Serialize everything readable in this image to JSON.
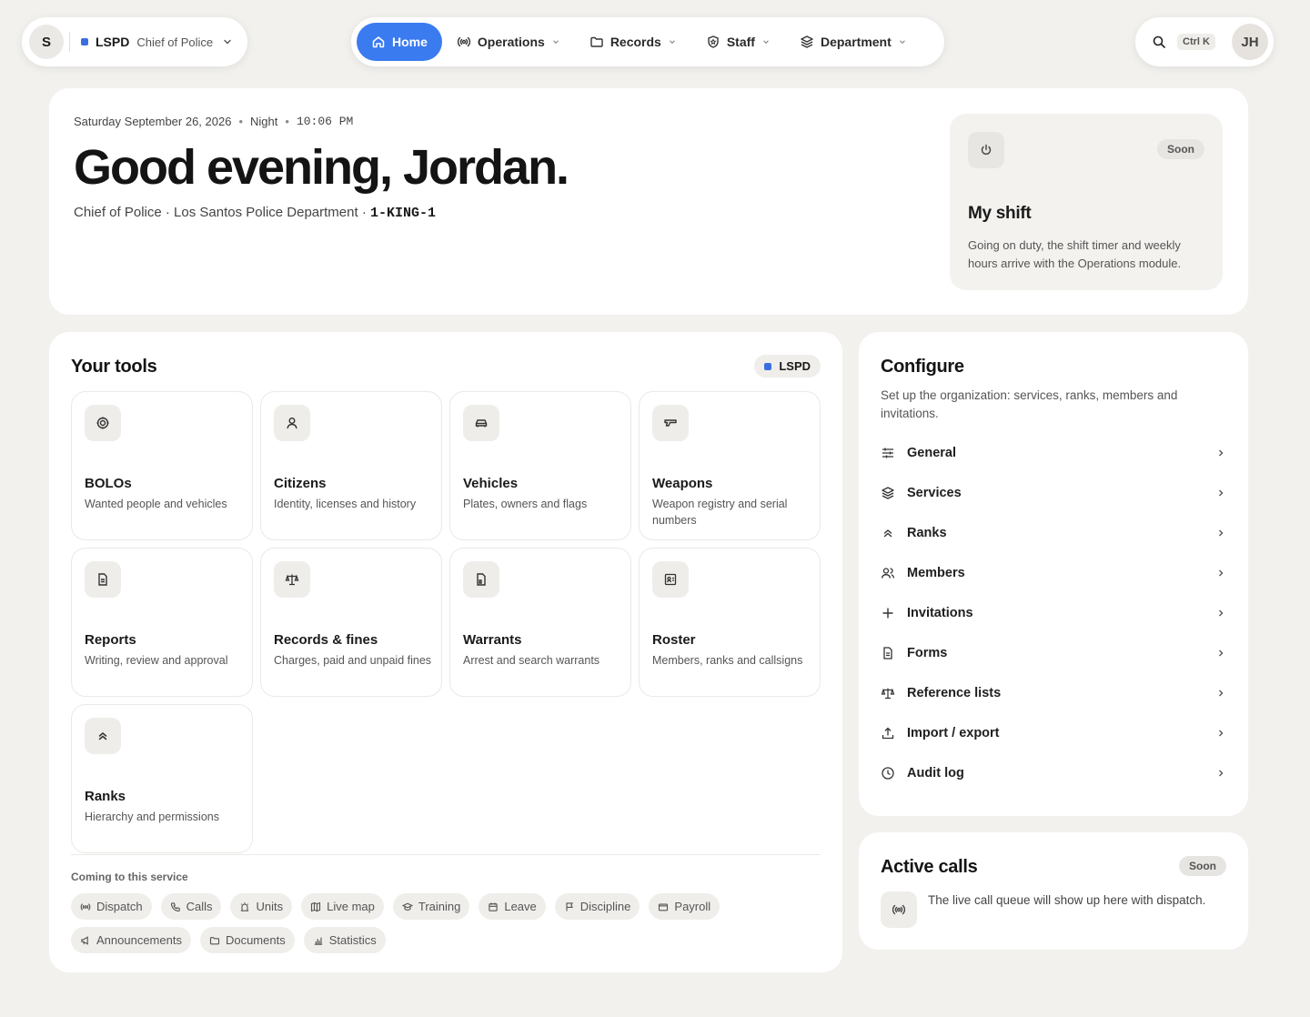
{
  "org_switcher": {
    "avatar": "S",
    "org": "LSPD",
    "role": "Chief of Police"
  },
  "nav": [
    {
      "label": "Home",
      "icon": "home-icon",
      "active": true
    },
    {
      "label": "Operations",
      "icon": "radio-icon"
    },
    {
      "label": "Records",
      "icon": "folder-icon"
    },
    {
      "label": "Staff",
      "icon": "shield-icon"
    },
    {
      "label": "Department",
      "icon": "layers-icon"
    }
  ],
  "utility": {
    "shortcut": "Ctrl K",
    "user_initials": "JH"
  },
  "hero": {
    "date": "Saturday September 26, 2026",
    "period": "Night",
    "time": "10:06 PM",
    "greeting": "Good evening, Jordan.",
    "subline": "Chief of Police · Los Santos Police Department ·",
    "callsign": "1-KING-1"
  },
  "shift": {
    "badge": "Soon",
    "title": "My shift",
    "description": "Going on duty, the shift timer and weekly hours arrive with the Operations module."
  },
  "tools": {
    "title": "Your tools",
    "tag": "LSPD",
    "items": [
      {
        "title": "BOLOs",
        "desc": "Wanted people and vehicles",
        "icon": "target-icon"
      },
      {
        "title": "Citizens",
        "desc": "Identity, licenses and history",
        "icon": "user-icon"
      },
      {
        "title": "Vehicles",
        "desc": "Plates, owners and flags",
        "icon": "car-icon"
      },
      {
        "title": "Weapons",
        "desc": "Weapon registry and serial numbers",
        "icon": "gun-icon"
      },
      {
        "title": "Reports",
        "desc": "Writing, review and approval",
        "icon": "document-icon"
      },
      {
        "title": "Records & fines",
        "desc": "Charges, paid and unpaid fines",
        "icon": "scale-icon"
      },
      {
        "title": "Warrants",
        "desc": "Arrest and search warrants",
        "icon": "warrant-icon"
      },
      {
        "title": "Roster",
        "desc": "Members, ranks and callsigns",
        "icon": "id-card-icon"
      },
      {
        "title": "Ranks",
        "desc": "Hierarchy and permissions",
        "icon": "chevrons-up-icon"
      }
    ],
    "coming_label": "Coming to this service",
    "coming": [
      {
        "label": "Dispatch",
        "icon": "radio-icon"
      },
      {
        "label": "Calls",
        "icon": "phone-icon"
      },
      {
        "label": "Units",
        "icon": "siren-icon"
      },
      {
        "label": "Live map",
        "icon": "map-icon"
      },
      {
        "label": "Training",
        "icon": "graduation-cap-icon"
      },
      {
        "label": "Leave",
        "icon": "calendar-icon"
      },
      {
        "label": "Discipline",
        "icon": "flag-icon"
      },
      {
        "label": "Payroll",
        "icon": "wallet-icon"
      },
      {
        "label": "Announcements",
        "icon": "megaphone-icon"
      },
      {
        "label": "Documents",
        "icon": "folder-icon"
      },
      {
        "label": "Statistics",
        "icon": "bar-chart-icon"
      }
    ]
  },
  "configure": {
    "title": "Configure",
    "description": "Set up the organization: services, ranks, members and invitations.",
    "items": [
      {
        "label": "General",
        "icon": "sliders-icon"
      },
      {
        "label": "Services",
        "icon": "layers-icon"
      },
      {
        "label": "Ranks",
        "icon": "chevrons-up-icon"
      },
      {
        "label": "Members",
        "icon": "users-icon"
      },
      {
        "label": "Invitations",
        "icon": "plus-icon"
      },
      {
        "label": "Forms",
        "icon": "document-icon"
      },
      {
        "label": "Reference lists",
        "icon": "scale-icon"
      },
      {
        "label": "Import / export",
        "icon": "upload-icon"
      },
      {
        "label": "Audit log",
        "icon": "clock-icon"
      }
    ]
  },
  "active_calls": {
    "title": "Active calls",
    "badge": "Soon",
    "description": "The live call queue will show up here with dispatch."
  },
  "colors": {
    "accent": "#3b7bf0",
    "background": "#f2f1ee",
    "org_dot": "#3b6fe0"
  }
}
